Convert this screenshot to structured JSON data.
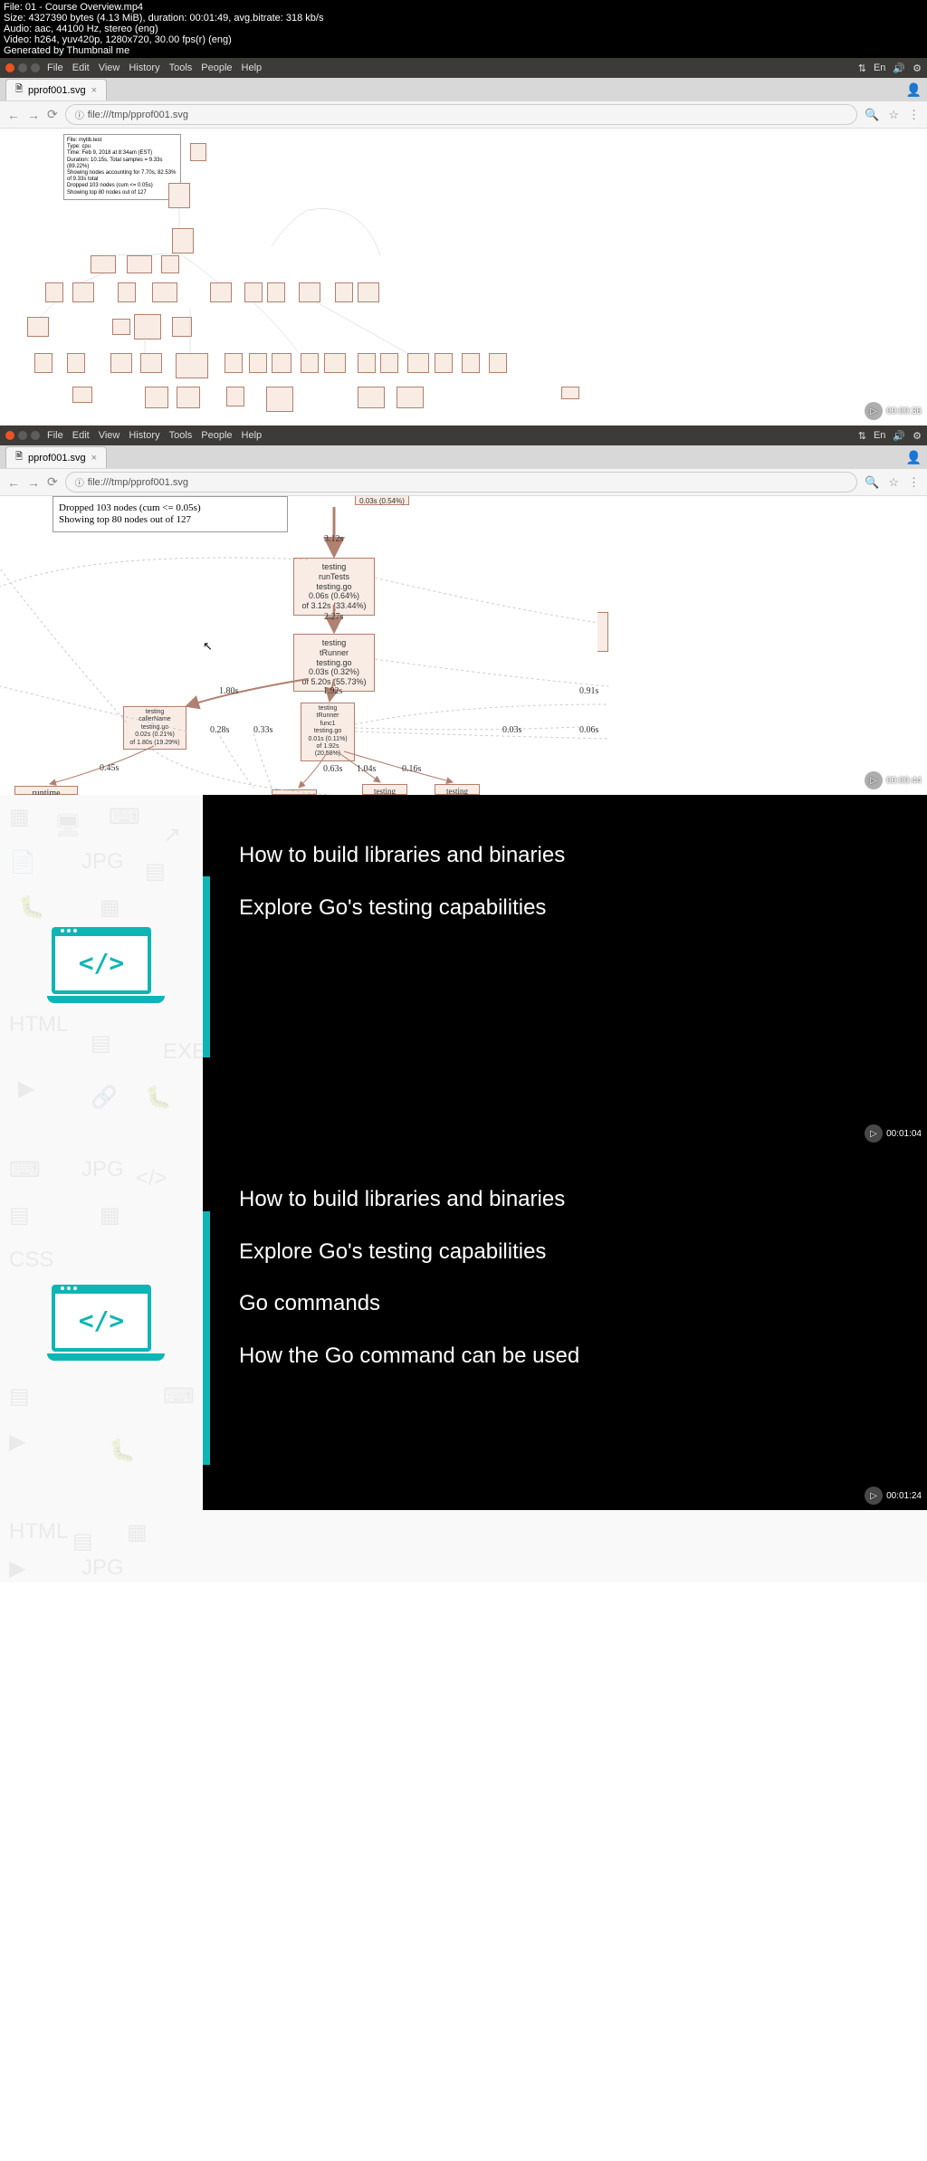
{
  "file_meta": {
    "line1": "File: 01 - Course Overview.mp4",
    "line2": "Size: 4327390 bytes (4.13 MiB), duration: 00:01:49, avg.bitrate: 318 kb/s",
    "line3": "Audio: aac, 44100 Hz, stereo (eng)",
    "line4": "Video: h264, yuv420p, 1280x720, 30.00 fps(r) (eng)",
    "line5": "Generated by Thumbnail me"
  },
  "menu": {
    "file": "File",
    "edit": "Edit",
    "view": "View",
    "history": "History",
    "tools": "Tools",
    "people": "People",
    "help": "Help"
  },
  "tab": {
    "title": "pprof001.svg"
  },
  "url": "file:///tmp/pprof001.svg",
  "legend": {
    "l1": "File: mylib.test",
    "l2": "Type: cpu",
    "l3": "Time: Feb 9, 2018 at 8:34am (EST)",
    "l4": "Duration: 10.15s, Total samples = 9.33s (89.22%)",
    "l5": "Showing nodes accounting for 7.70s, 82.53% of 9.33s total",
    "l6": "Dropped 103 nodes (cum <= 0.05s)",
    "l7": "Showing top 80 nodes out of 127"
  },
  "legend2": {
    "l1": "Dropped 103 nodes (cum <= 0.05s)",
    "l2": "Showing top 80 nodes out of 127"
  },
  "nodes2": {
    "runTests": {
      "l1": "testing",
      "l2": "runTests",
      "l3": "testing.go",
      "l4": "0.06s (0.64%)",
      "l5": "of 3.12s (33.44%)"
    },
    "tRunner": {
      "l1": "testing",
      "l2": "tRunner",
      "l3": "testing.go",
      "l4": "0.03s (0.32%)",
      "l5": "of 5.20s (55.73%)"
    },
    "callerName": {
      "l1": "testing",
      "l2": "callerName",
      "l3": "testing.go",
      "l4": "0.02s (0.21%)",
      "l5": "of 1.80s (19.29%)"
    },
    "tRunnerFunc": {
      "l1": "testing",
      "l2": "tRunner",
      "l3": "func1",
      "l4": "testing.go",
      "l5": "0.01s (0.11%)",
      "l6": "of 1.92s (20.58%)"
    }
  },
  "edges2": {
    "e312": "3.12s",
    "e227": "2.27s",
    "e180": "1.80s",
    "e192": "1.92s",
    "e091": "0.91s",
    "e045": "0.45s",
    "e063": "0.63s",
    "e104": "1.04s",
    "e016": "0.16s",
    "e003": "0.03s",
    "e006": "0.06s",
    "e028": "0.28s",
    "e033": "0.33s",
    "top1": "0.03s (0.54%)"
  },
  "labels2": {
    "runtime": "runtime",
    "testing1": "testing",
    "testing2": "testing"
  },
  "slide1": {
    "line1": "How to build libraries and binaries",
    "line2": "Explore Go's testing capabilities"
  },
  "slide2": {
    "line1": "How to build libraries and binaries",
    "line2": "Explore Go's testing capabilities",
    "line3": "Go commands",
    "line4": "How the Go command can be used"
  },
  "timestamps": {
    "t1": "00:00:36",
    "t2": "00:00:44",
    "t3": "00:01:04",
    "t4": "00:01:24"
  },
  "titlebar_badge": "En"
}
